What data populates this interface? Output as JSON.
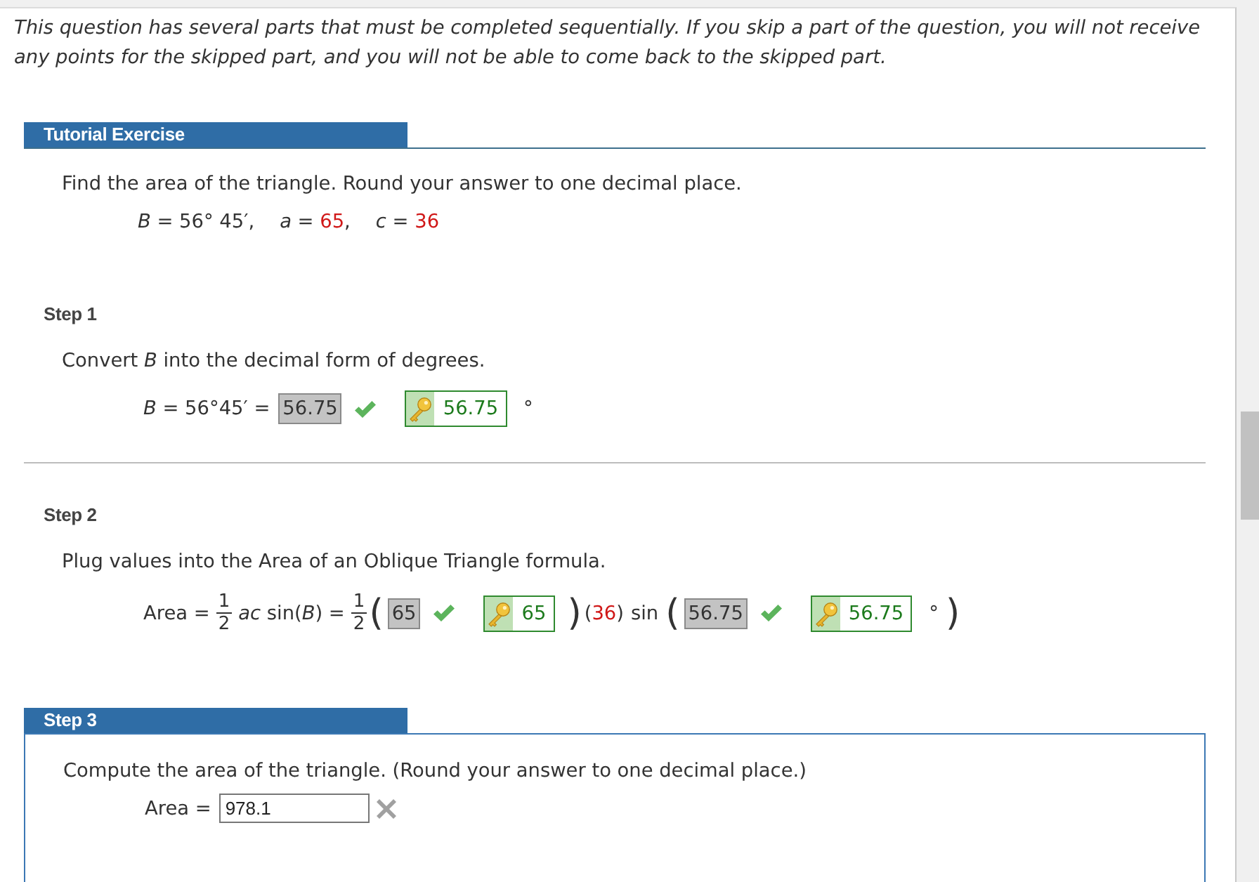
{
  "instructions": "This question has several parts that must be completed sequentially. If you skip a part of the question, you will not receive any points for the skipped part, and you will not be able to come back to the skipped part.",
  "tutorial": {
    "header": "Tutorial Exercise",
    "prompt": "Find the area of the triangle. Round your answer to one decimal place.",
    "givens": [
      {
        "kind": "text",
        "text": "*B* = 56° 45′,"
      },
      {
        "kind": "given",
        "before": "*a* = ",
        "value": "65",
        "after": ","
      },
      {
        "kind": "given",
        "before": "*c* = ",
        "value": "36"
      }
    ]
  },
  "steps": [
    {
      "header": "Step 1",
      "current": false,
      "prompt": "Convert *B* into the decimal form of degrees.",
      "equation": [
        {
          "kind": "text",
          "text": "*B* = 56°45′ ="
        },
        {
          "kind": "answer",
          "response": "56.75",
          "correct": true,
          "solution": "56.75"
        },
        {
          "kind": "text",
          "text": "°"
        }
      ]
    },
    {
      "header": "Step 2",
      "current": false,
      "prompt": "Plug values into the Area of an Oblique Triangle formula.",
      "equation": [
        {
          "kind": "text",
          "text": "Area ="
        },
        {
          "kind": "fraction",
          "numerator": "1",
          "denominator": "2"
        },
        {
          "kind": "text",
          "text": "*ac* sin(*B*) ="
        },
        {
          "kind": "fraction",
          "numerator": "1",
          "denominator": "2"
        },
        {
          "kind": "paren",
          "text": "("
        },
        {
          "kind": "answer",
          "response": "65",
          "correct": true,
          "solution": "65"
        },
        {
          "kind": "paren",
          "text": ")"
        },
        {
          "kind": "given",
          "before": "(",
          "value": "36",
          "after": ")"
        },
        {
          "kind": "text",
          "text": "sin"
        },
        {
          "kind": "paren",
          "text": "("
        },
        {
          "kind": "answer",
          "response": "56.75",
          "correct": true,
          "solution": "56.75"
        },
        {
          "kind": "text",
          "text": "°"
        },
        {
          "kind": "paren",
          "text": ")"
        }
      ]
    },
    {
      "header": "Step 3",
      "current": true,
      "prompt": "Compute the area of the triangle. (Round your answer to one decimal place.)",
      "equation": [
        {
          "kind": "text",
          "text": "Area ="
        },
        {
          "kind": "answer",
          "response": "978.1",
          "correct": false
        }
      ]
    }
  ]
}
